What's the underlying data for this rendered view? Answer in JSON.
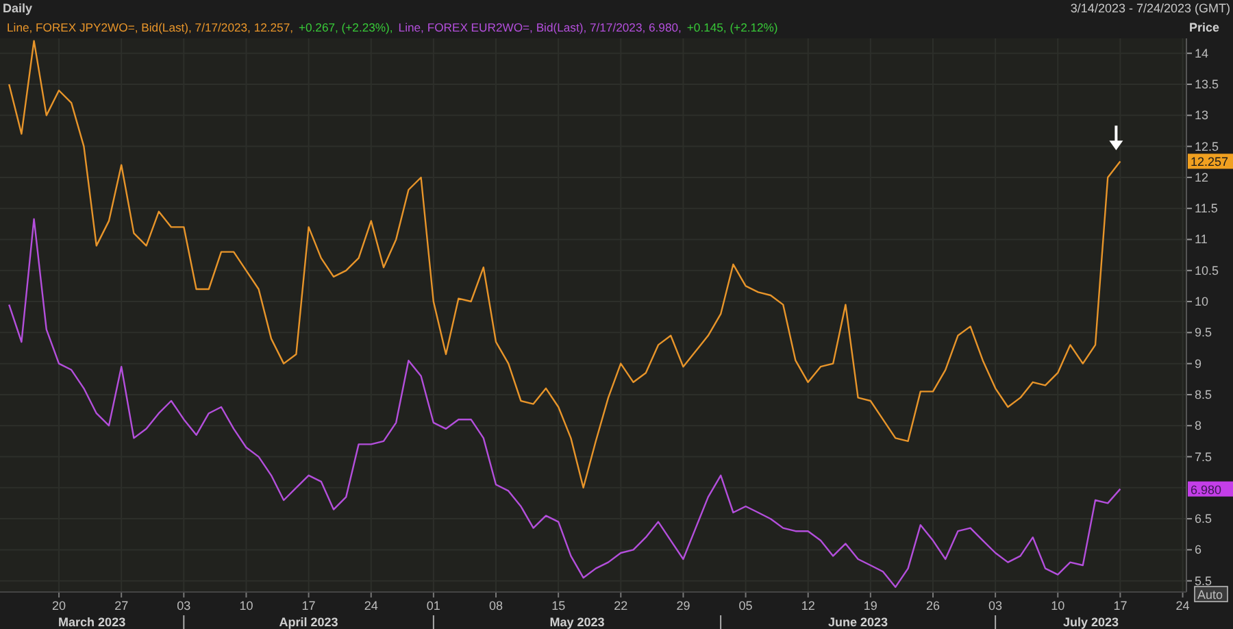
{
  "title": "Daily",
  "date_range": "3/14/2023 - 7/24/2023 (GMT)",
  "legend": [
    {
      "prefix": "Line, ",
      "suffix": ", Bid(Last), 7/17/2023, 12.257,",
      "change": "+0.267, (+2.23%),"
    },
    {
      "prefix": "Line, ",
      "suffix": ", Bid(Last), 7/17/2023, 6.980,",
      "change": "+0.145, (+2.12%)"
    }
  ],
  "chart": {
    "chart_data": {
      "type": "line",
      "ylabel": "Price",
      "grid": true,
      "categories": [
        null,
        null,
        null,
        null,
        "20",
        null,
        null,
        null,
        null,
        "27",
        null,
        null,
        null,
        null,
        "03",
        null,
        null,
        null,
        null,
        "10",
        null,
        null,
        null,
        null,
        "17",
        null,
        null,
        null,
        null,
        "24",
        null,
        null,
        null,
        null,
        "01",
        null,
        null,
        null,
        null,
        "08",
        null,
        null,
        null,
        null,
        "15",
        null,
        null,
        null,
        null,
        "22",
        null,
        null,
        null,
        null,
        "29",
        null,
        null,
        null,
        null,
        "05",
        null,
        null,
        null,
        null,
        "12",
        null,
        null,
        null,
        null,
        "19",
        null,
        null,
        null,
        null,
        "26",
        null,
        null,
        null,
        null,
        "03",
        null,
        null,
        null,
        null,
        "10",
        null,
        null,
        null,
        null,
        "17",
        null,
        null,
        null,
        null,
        "24"
      ],
      "series": [
        {
          "name": "FOREX JPY2WO=",
          "color": "#e8952a",
          "values": [
            13.5,
            12.7,
            14.2,
            13.0,
            13.4,
            13.2,
            12.5,
            10.9,
            11.3,
            12.2,
            11.1,
            10.9,
            11.45,
            11.2,
            11.2,
            10.2,
            10.2,
            10.8,
            10.8,
            10.5,
            10.2,
            9.4,
            9.0,
            9.15,
            11.2,
            10.7,
            10.4,
            10.5,
            10.7,
            11.3,
            10.55,
            11.0,
            11.8,
            12.0,
            10.0,
            9.15,
            10.05,
            10.0,
            10.55,
            9.35,
            9.0,
            8.4,
            8.35,
            8.6,
            8.3,
            7.8,
            7.0,
            7.75,
            8.45,
            9.0,
            8.7,
            8.85,
            9.3,
            9.45,
            8.95,
            9.2,
            9.45,
            9.8,
            10.6,
            10.25,
            10.15,
            10.1,
            9.95,
            9.05,
            8.7,
            8.95,
            9.0,
            9.95,
            8.45,
            8.4,
            8.1,
            7.8,
            7.75,
            8.55,
            8.55,
            8.9,
            9.45,
            9.6,
            9.05,
            8.6,
            8.3,
            8.45,
            8.7,
            8.65,
            8.85,
            9.3,
            9.0,
            9.3,
            12.0,
            12.26,
            null,
            null,
            null,
            null,
            null
          ]
        },
        {
          "name": "FOREX EUR2WO=",
          "color": "#b44fdc",
          "values": [
            9.95,
            9.35,
            11.33,
            9.55,
            9.0,
            8.9,
            8.6,
            8.2,
            8.0,
            8.95,
            7.8,
            7.95,
            8.2,
            8.4,
            8.1,
            7.85,
            8.2,
            8.3,
            7.95,
            7.65,
            7.5,
            7.2,
            6.8,
            7.0,
            7.2,
            7.1,
            6.65,
            6.85,
            7.7,
            7.7,
            7.75,
            8.05,
            9.05,
            8.8,
            8.05,
            7.95,
            8.1,
            8.1,
            7.8,
            7.05,
            6.95,
            6.7,
            6.35,
            6.55,
            6.45,
            5.9,
            5.55,
            5.7,
            5.8,
            5.95,
            6.0,
            6.2,
            6.45,
            6.15,
            5.85,
            6.35,
            6.85,
            7.2,
            6.6,
            6.7,
            6.6,
            6.5,
            6.35,
            6.3,
            6.3,
            6.15,
            5.9,
            6.1,
            5.85,
            5.75,
            5.65,
            5.4,
            5.7,
            6.4,
            6.15,
            5.85,
            6.3,
            6.35,
            6.15,
            5.95,
            5.8,
            5.9,
            6.2,
            5.7,
            5.6,
            5.8,
            5.75,
            6.8,
            6.75,
            6.98,
            null,
            null,
            null,
            null,
            null
          ]
        }
      ],
      "ylim": [
        5.32,
        14.24
      ],
      "yticks": [
        5.5,
        6,
        6.5,
        7.5,
        8,
        8.5,
        9,
        9.5,
        10,
        10.5,
        11,
        11.5,
        12,
        12.5,
        13,
        13.5,
        14
      ]
    },
    "months": [
      "March 2023",
      "April 2023",
      "May 2023",
      "June 2023",
      "July 2023"
    ],
    "value_tags": [
      "12.257",
      "6.980"
    ],
    "auto_button": "Auto"
  }
}
